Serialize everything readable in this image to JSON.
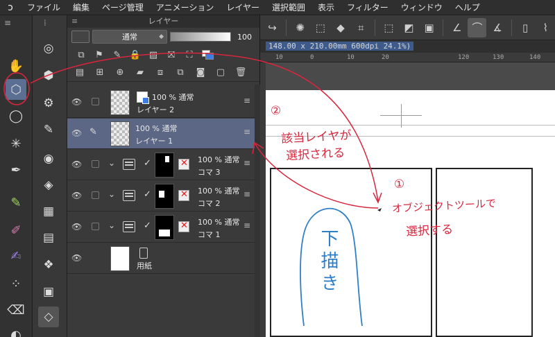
{
  "menubar": {
    "items": [
      "ファイル",
      "編集",
      "ページ管理",
      "アニメーション",
      "レイヤー",
      "選択範囲",
      "表示",
      "フィルター",
      "ウィンドウ",
      "ヘルプ"
    ]
  },
  "status": {
    "text": "148.00 x 210.00mm 600dpi 24.1%)"
  },
  "ruler": {
    "ticks": [
      "10",
      "0",
      "10",
      "20",
      "120",
      "130",
      "140"
    ]
  },
  "layer_panel": {
    "title": "レイヤー",
    "blend_mode": "通常",
    "opacity": "100",
    "layers": [
      {
        "info": "100 % 通常",
        "name": "レイヤー 2"
      },
      {
        "info": "100 % 通常",
        "name": "レイヤー 1"
      },
      {
        "info": "100 % 通常",
        "name": "コマ 3"
      },
      {
        "info": "100 % 通常",
        "name": "コマ 2"
      },
      {
        "info": "100 % 通常",
        "name": "コマ 1"
      },
      {
        "info": "",
        "name": "用紙"
      }
    ]
  },
  "annotations": {
    "step2_num": "②",
    "step2_line1": "該当レイヤが",
    "step2_line2": "選択される",
    "step1_num": "①",
    "step1_line1": "オブジェクトツールで",
    "step1_line2": "選択する",
    "canvas_text": "下描き"
  },
  "colors": {
    "annotation": "#d7263d",
    "sketch": "#2f7fc8",
    "selected_layer": "#5b6785",
    "accent": "#3b7de0"
  }
}
